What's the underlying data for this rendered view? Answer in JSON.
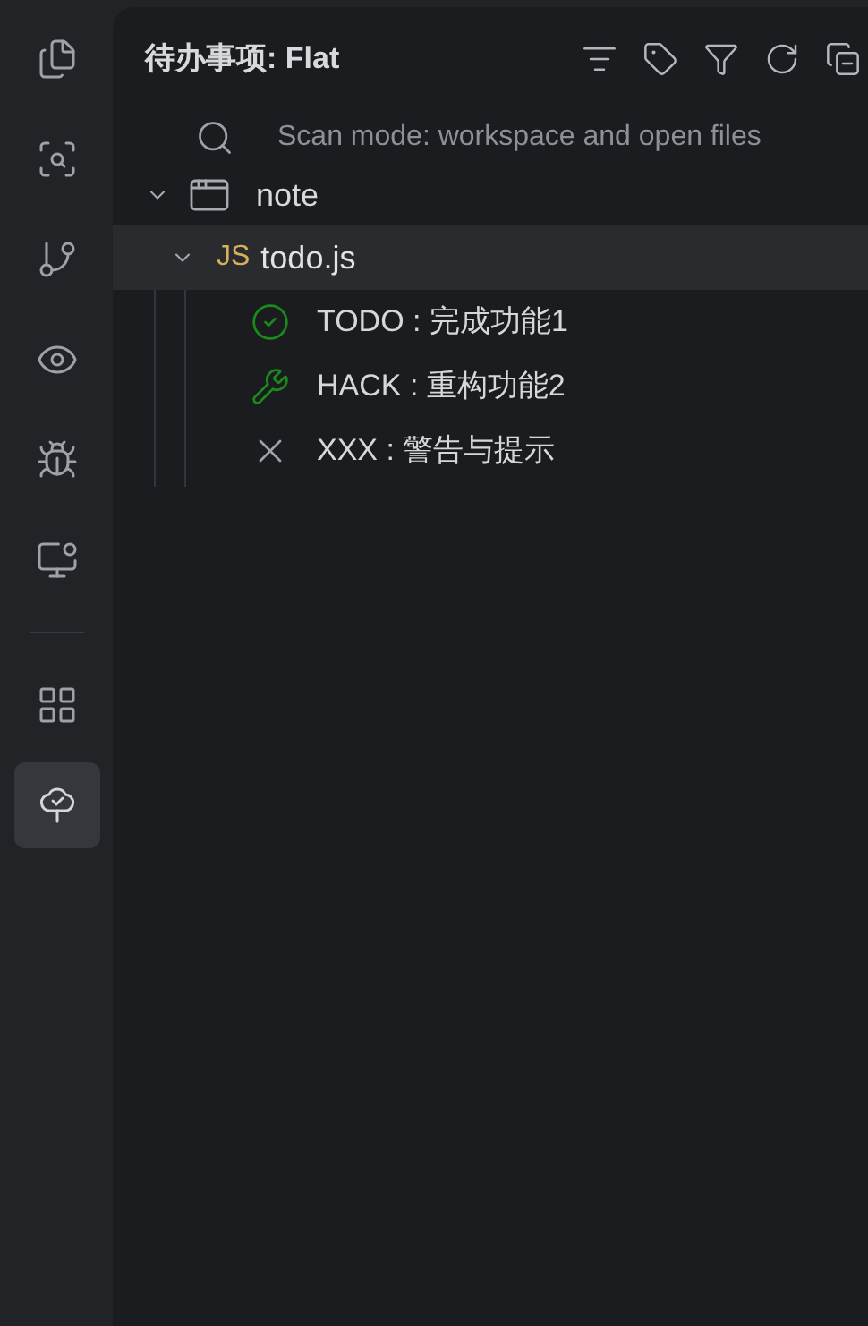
{
  "activity_bar": [
    {
      "kind": "files",
      "selected": false
    },
    {
      "kind": "search",
      "selected": false
    },
    {
      "kind": "branch",
      "selected": false
    },
    {
      "kind": "eye",
      "selected": false
    },
    {
      "kind": "bug",
      "selected": false
    },
    {
      "kind": "remote",
      "selected": false
    },
    {
      "kind": "divider"
    },
    {
      "kind": "grid",
      "selected": false
    },
    {
      "kind": "tree",
      "selected": true
    }
  ],
  "panel": {
    "title": "待办事项: Flat",
    "toolbar": [
      {
        "kind": "list"
      },
      {
        "kind": "tag"
      },
      {
        "kind": "filter"
      },
      {
        "kind": "refresh"
      },
      {
        "kind": "collapse"
      }
    ]
  },
  "scan_mode": "Scan mode: workspace and open files",
  "tree": [
    {
      "label": "note",
      "expanded": true,
      "selected": false,
      "children": [
        {
          "badge": "JS",
          "label": "todo.js",
          "expanded": true,
          "selected": true,
          "children": [
            {
              "kind": "todo",
              "label": "TODO : 完成功能1"
            },
            {
              "kind": "hack",
              "label": "HACK : 重构功能2"
            },
            {
              "kind": "xxx",
              "label": "XXX : 警告与提示"
            }
          ]
        }
      ]
    }
  ]
}
